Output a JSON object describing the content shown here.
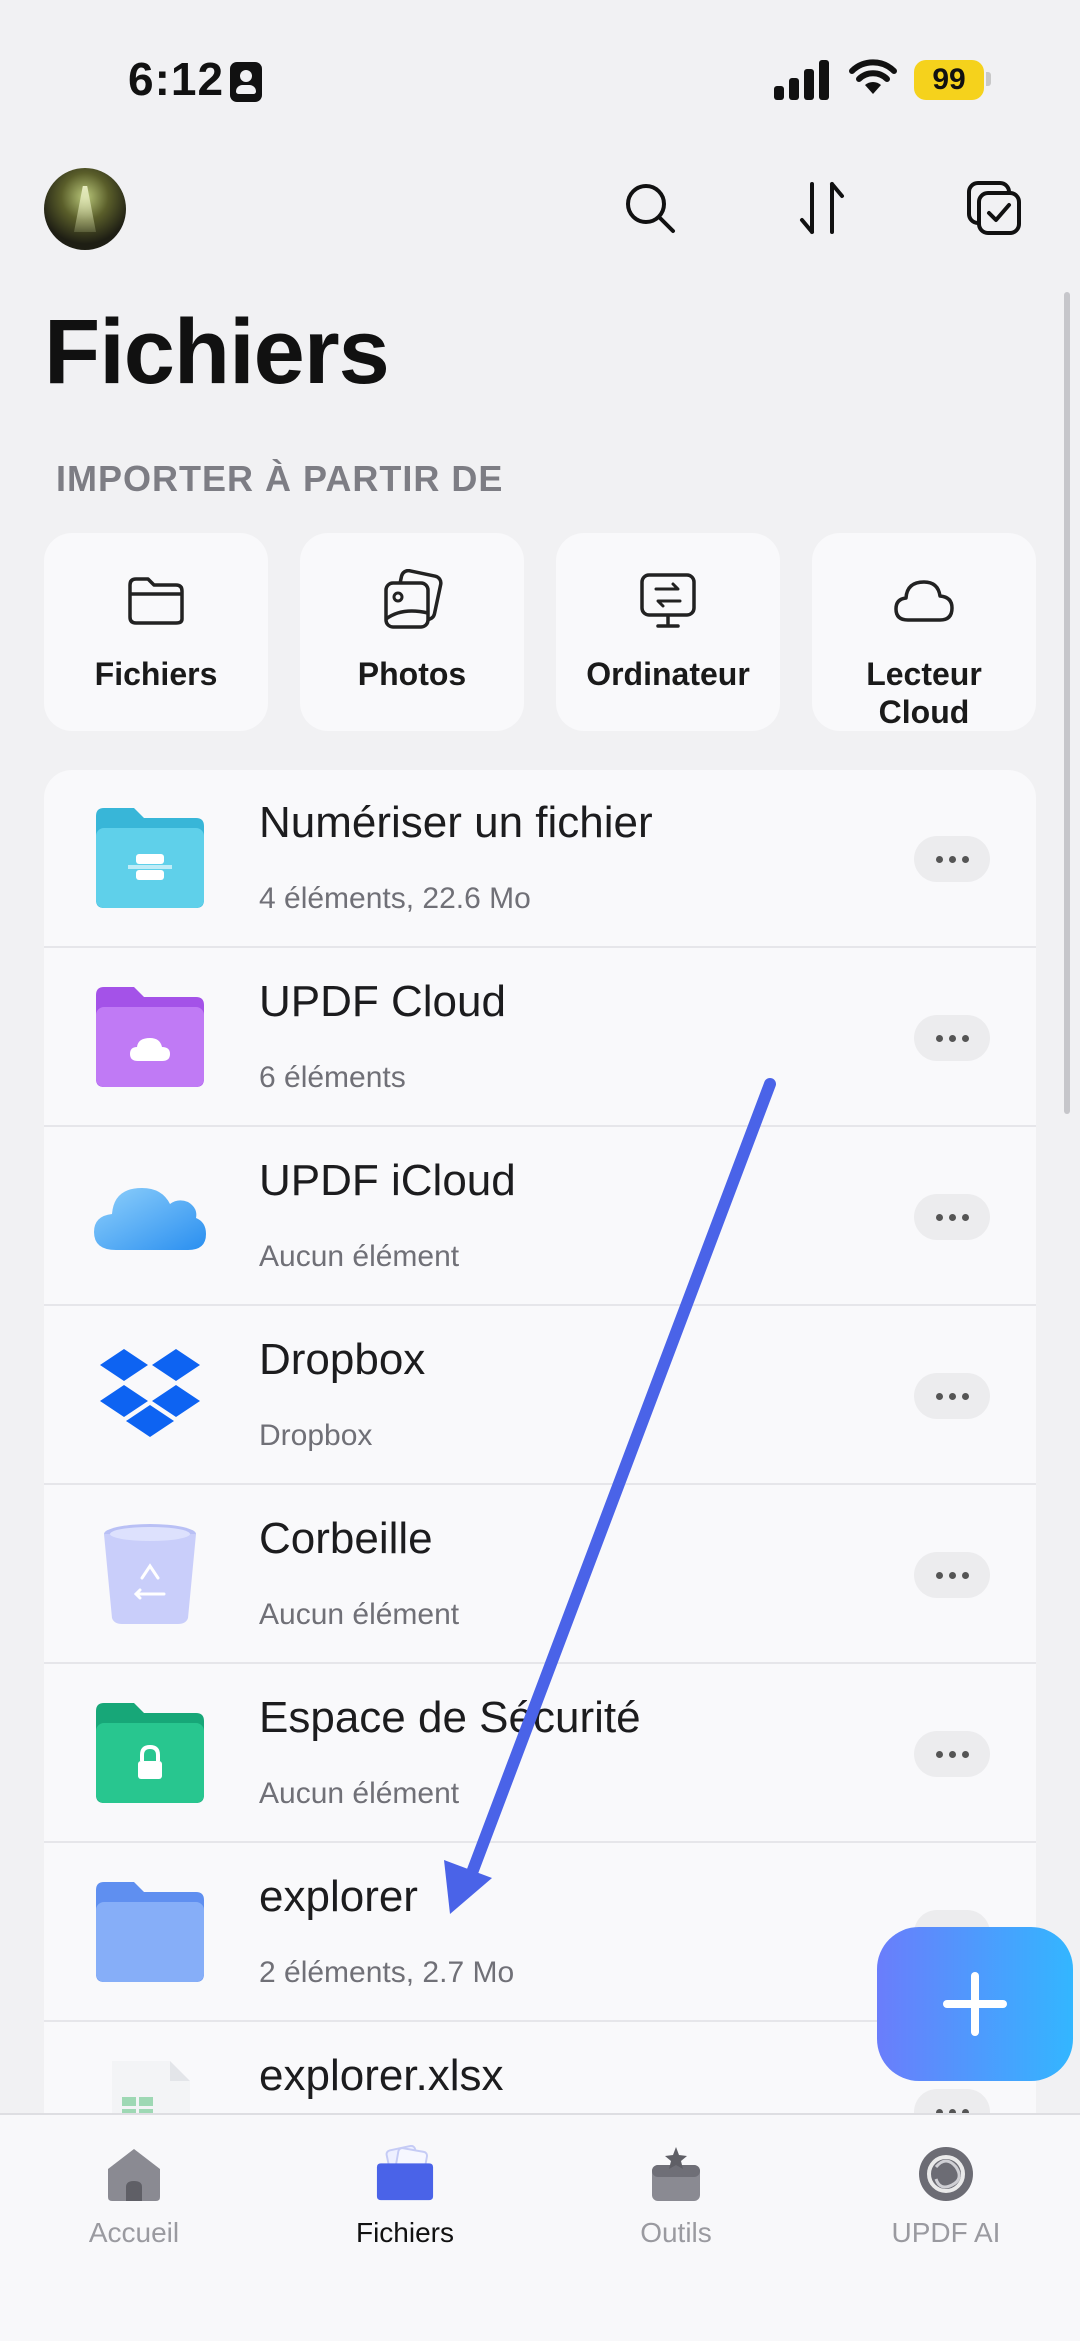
{
  "status_bar": {
    "time": "6:12",
    "battery": "99"
  },
  "header": {
    "title": "Fichiers"
  },
  "import": {
    "label": "IMPORTER À PARTIR DE",
    "sources": [
      {
        "label": "Fichiers",
        "icon": "folder-icon"
      },
      {
        "label": "Photos",
        "icon": "photos-icon"
      },
      {
        "label": "Ordinateur",
        "icon": "computer-transfer-icon"
      },
      {
        "label": "Lecteur Cloud",
        "icon": "cloud-icon"
      }
    ]
  },
  "files": [
    {
      "name": "Numériser un fichier",
      "sub": "4 éléments, 22.6 Mo",
      "icon": "scan-folder-icon"
    },
    {
      "name": "UPDF Cloud",
      "sub": "6 éléments",
      "icon": "updf-cloud-folder-icon"
    },
    {
      "name": "UPDF iCloud",
      "sub": "Aucun élément",
      "icon": "icloud-icon"
    },
    {
      "name": "Dropbox",
      "sub": "Dropbox",
      "icon": "dropbox-icon"
    },
    {
      "name": "Corbeille",
      "sub": "Aucun élément",
      "icon": "trash-bin-icon"
    },
    {
      "name": "Espace de Sécurité",
      "sub": "Aucun élément",
      "icon": "lock-folder-icon"
    },
    {
      "name": "explorer",
      "sub": "2 éléments, 2.7 Mo",
      "icon": "folder-icon"
    },
    {
      "name": "explorer.xlsx",
      "sub": "",
      "icon": "xlsx-file-icon"
    }
  ],
  "tabs": [
    {
      "label": "Accueil",
      "icon": "home-icon",
      "active": false
    },
    {
      "label": "Fichiers",
      "icon": "files-icon",
      "active": true
    },
    {
      "label": "Outils",
      "icon": "tools-icon",
      "active": false
    },
    {
      "label": "UPDF AI",
      "icon": "ai-icon",
      "active": false
    }
  ],
  "colors": {
    "accent": "#4a63e8",
    "annotation_arrow": "#4a63e8",
    "battery": "#f5d21c"
  }
}
